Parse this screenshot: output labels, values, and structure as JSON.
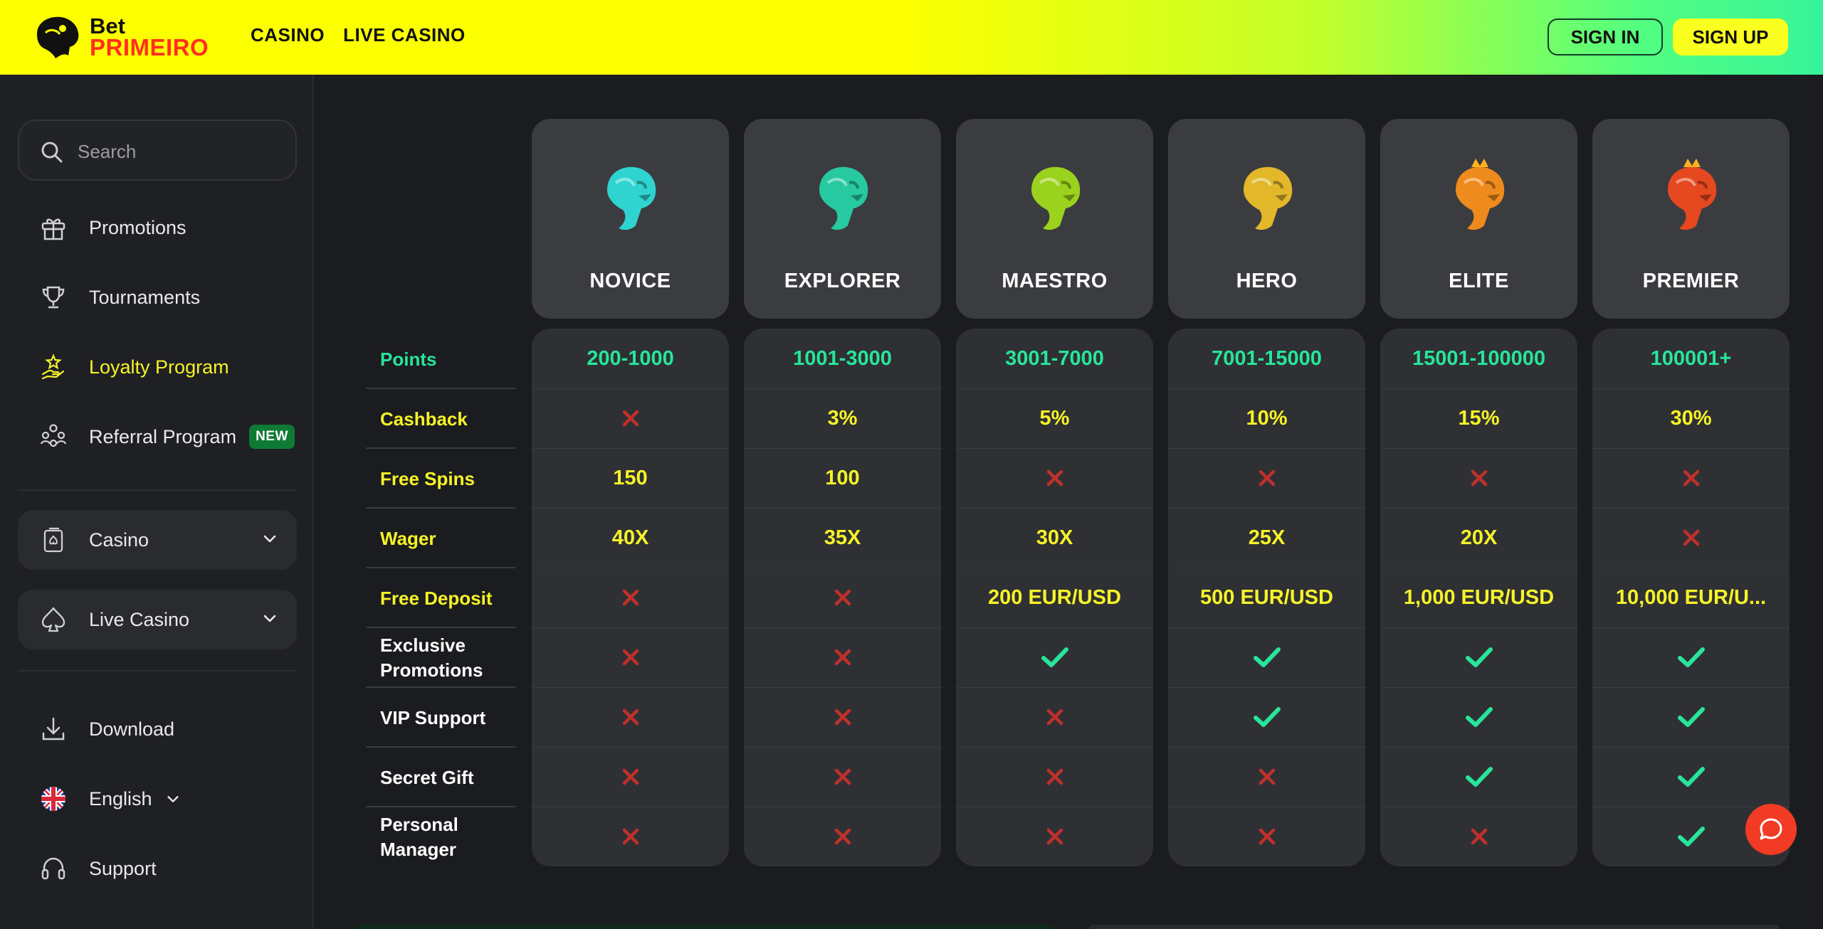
{
  "header": {
    "logo": {
      "line1": "Bet",
      "line2": "PRIMEIRO"
    },
    "nav": [
      {
        "label": "CASINO"
      },
      {
        "label": "LIVE CASINO"
      }
    ],
    "signin_label": "SIGN IN",
    "signup_label": "SIGN UP"
  },
  "sidebar": {
    "search": {
      "placeholder": "Search",
      "value": "",
      "icon": "search-icon"
    },
    "items": [
      {
        "label": "Promotions",
        "icon": "gift-icon"
      },
      {
        "label": "Tournaments",
        "icon": "trophy-icon"
      },
      {
        "label": "Loyalty Program",
        "icon": "loyalty-hand-icon",
        "active": true
      },
      {
        "label": "Referral Program",
        "icon": "referral-people-icon",
        "badge": "NEW"
      }
    ],
    "groups": [
      {
        "label": "Casino",
        "icon": "casino-cards-icon"
      },
      {
        "label": "Live Casino",
        "icon": "spade-icon"
      }
    ],
    "bottom": [
      {
        "label": "Download",
        "icon": "download-icon"
      },
      {
        "label": "English",
        "icon": "uk-flag-icon"
      },
      {
        "label": "Support",
        "icon": "headset-icon"
      }
    ]
  },
  "loyalty": {
    "row_labels": [
      "Points",
      "Cashback",
      "Free Spins",
      "Wager",
      "Free Deposit",
      "Exclusive Promotions",
      "VIP Support",
      "Secret Gift",
      "Personal Manager"
    ],
    "tiers": [
      {
        "name": "NOVICE",
        "color": "#2fd4d0",
        "points": "200-1000",
        "cashback": "x",
        "free_spins": "150",
        "wager": "40X",
        "free_deposit": "x",
        "exclusive": "x",
        "vip": "x",
        "gift": "x",
        "manager": "x"
      },
      {
        "name": "EXPLORER",
        "color": "#27c9a0",
        "points": "1001-3000",
        "cashback": "3%",
        "free_spins": "100",
        "wager": "35X",
        "free_deposit": "x",
        "exclusive": "x",
        "vip": "x",
        "gift": "x",
        "manager": "x"
      },
      {
        "name": "MAESTRO",
        "color": "#9ad21d",
        "points": "3001-7000",
        "cashback": "5%",
        "free_spins": "x",
        "wager": "30X",
        "free_deposit": "200 EUR/USD",
        "exclusive": "check",
        "vip": "x",
        "gift": "x",
        "manager": "x"
      },
      {
        "name": "HERO",
        "color": "#e2b82a",
        "points": "7001-15000",
        "cashback": "10%",
        "free_spins": "x",
        "wager": "25X",
        "free_deposit": "500 EUR/USD",
        "exclusive": "check",
        "vip": "check",
        "gift": "x",
        "manager": "x"
      },
      {
        "name": "ELITE",
        "color": "#ef8a1c",
        "points": "15001-100000",
        "cashback": "15%",
        "free_spins": "x",
        "wager": "20X",
        "free_deposit": "1,000 EUR/USD",
        "exclusive": "check",
        "vip": "check",
        "gift": "check",
        "manager": "x"
      },
      {
        "name": "PREMIER",
        "color": "#e6481f",
        "points": "100001+",
        "cashback": "30%",
        "free_spins": "x",
        "wager": "x",
        "free_deposit": "10,000 EUR/U...",
        "exclusive": "check",
        "vip": "check",
        "gift": "check",
        "manager": "check"
      }
    ]
  },
  "colors": {
    "accent_yellow": "#f6f328",
    "accent_green": "#27e59a",
    "cross_red": "#c0302a"
  }
}
